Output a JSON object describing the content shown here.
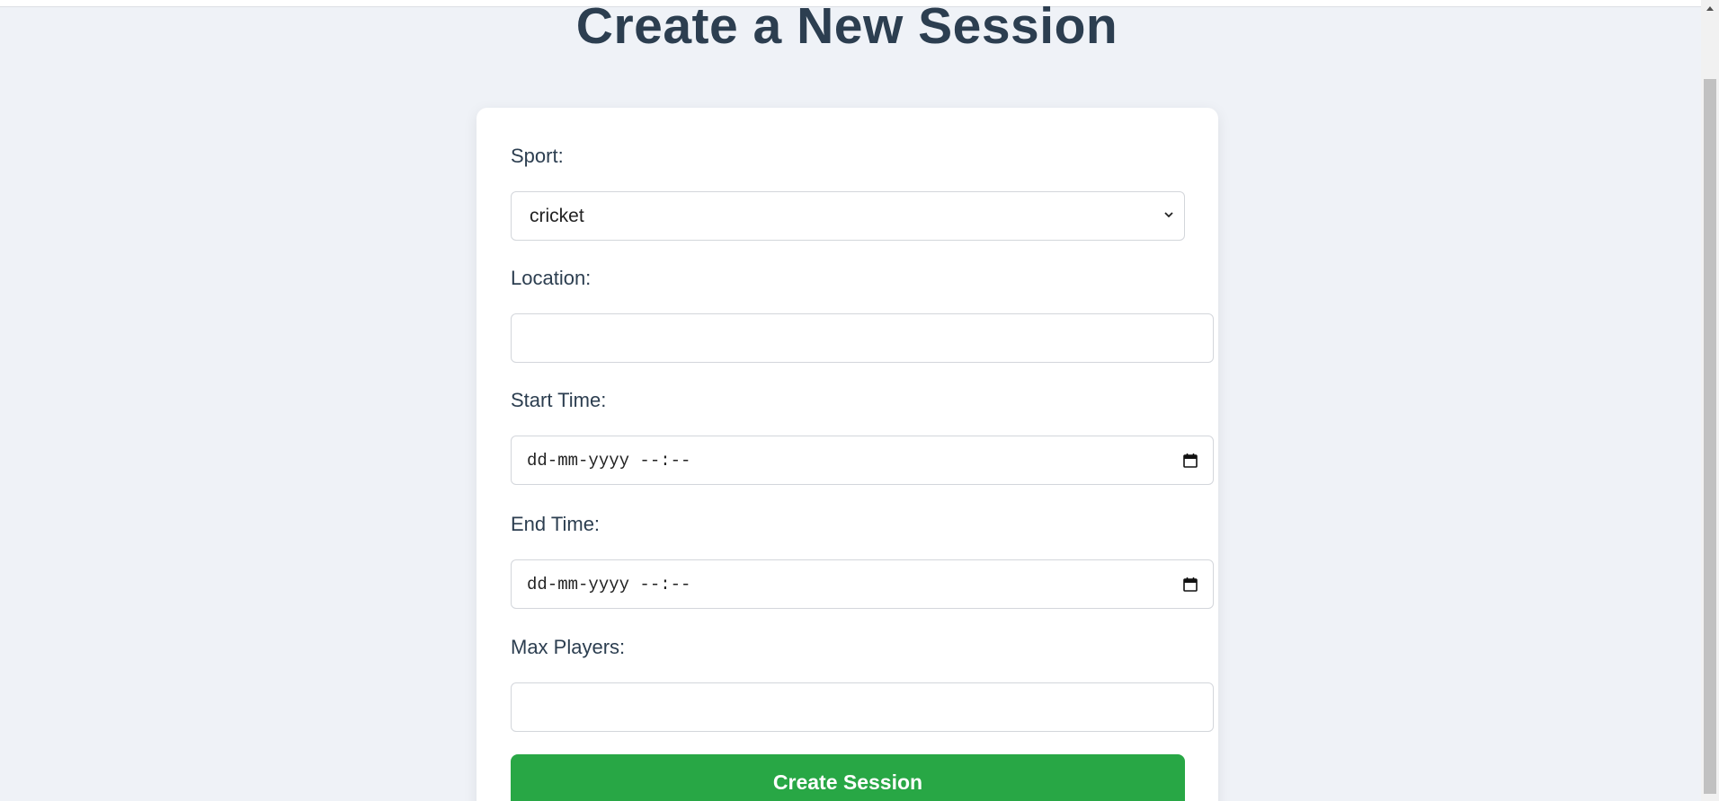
{
  "page": {
    "title": "Create a New Session"
  },
  "form": {
    "sport": {
      "label": "Sport:",
      "value": "cricket"
    },
    "location": {
      "label": "Location:",
      "value": ""
    },
    "start_time": {
      "label": "Start Time:",
      "value": "dd-mm-yyyy --:--"
    },
    "end_time": {
      "label": "End Time:",
      "value": "dd-mm-yyyy --:--"
    },
    "max_players": {
      "label": "Max Players:",
      "value": ""
    },
    "submit_label": "Create Session"
  },
  "colors": {
    "background": "#eff2f7",
    "heading": "#2c3e50",
    "submit": "#28a745"
  },
  "icons": {
    "select_chevron": "chevron-down-icon",
    "date_picker": "calendar-icon",
    "scroll_up": "scroll-up-arrow-icon"
  }
}
